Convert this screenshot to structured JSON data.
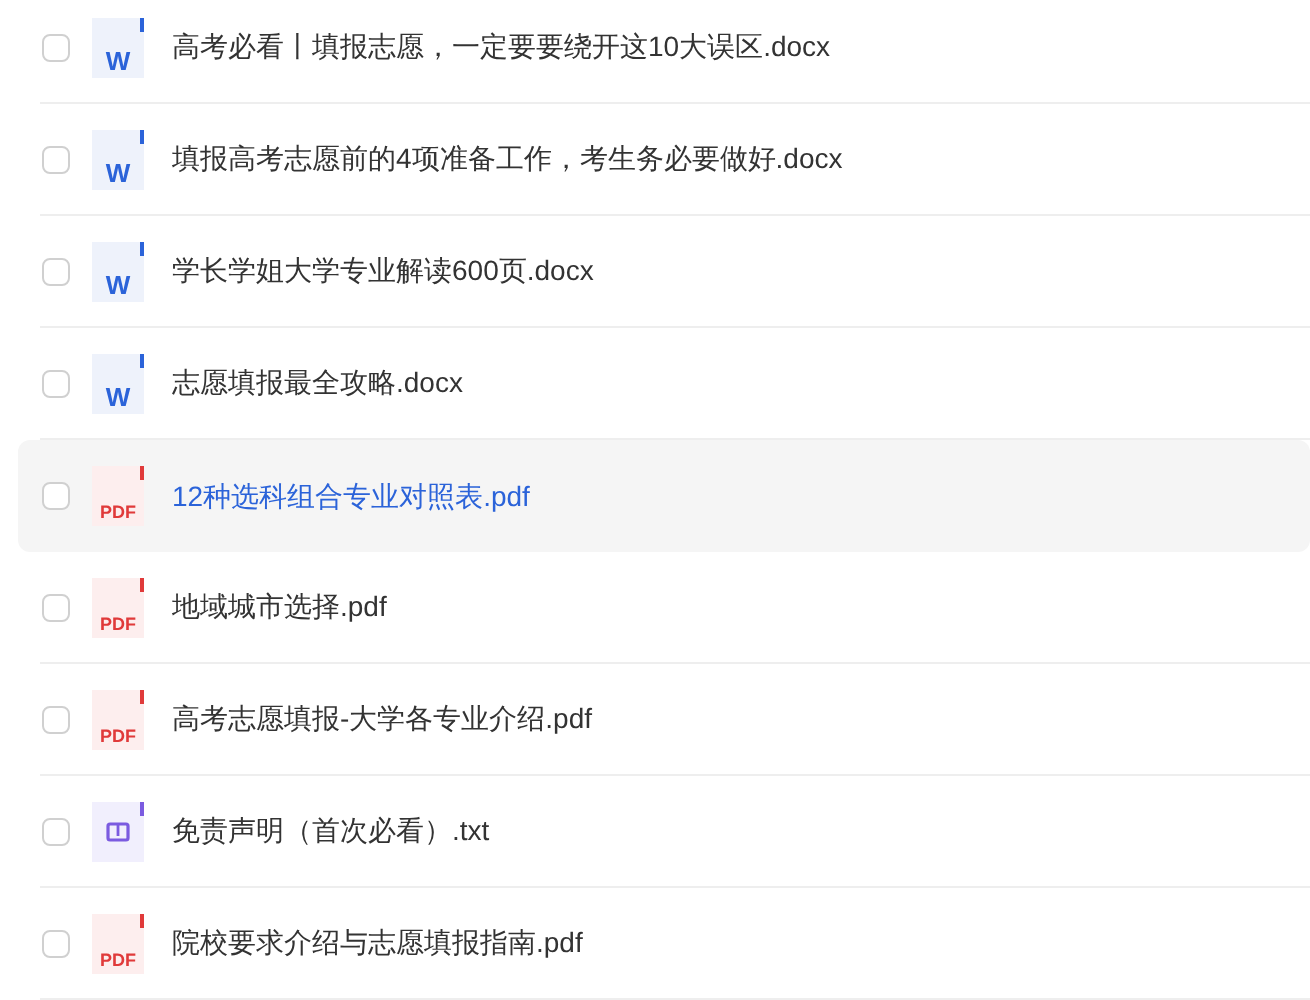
{
  "files": [
    {
      "name": "高考必看丨填报志愿，一定要要绕开这10大误区.docx",
      "kind": "docx",
      "icon_label": "W",
      "checked": false,
      "highlighted": false
    },
    {
      "name": "填报高考志愿前的4项准备工作，考生务必要做好.docx",
      "kind": "docx",
      "icon_label": "W",
      "checked": false,
      "highlighted": false
    },
    {
      "name": "学长学姐大学专业解读600页.docx",
      "kind": "docx",
      "icon_label": "W",
      "checked": false,
      "highlighted": false
    },
    {
      "name": "志愿填报最全攻略.docx",
      "kind": "docx",
      "icon_label": "W",
      "checked": false,
      "highlighted": false
    },
    {
      "name": "12种选科组合专业对照表.pdf",
      "kind": "pdf",
      "icon_label": "PDF",
      "checked": false,
      "highlighted": true
    },
    {
      "name": "地域城市选择.pdf",
      "kind": "pdf",
      "icon_label": "PDF",
      "checked": false,
      "highlighted": false
    },
    {
      "name": "高考志愿填报-大学各专业介绍.pdf",
      "kind": "pdf",
      "icon_label": "PDF",
      "checked": false,
      "highlighted": false
    },
    {
      "name": "免责声明（首次必看）.txt",
      "kind": "txt",
      "checked": false,
      "highlighted": false
    },
    {
      "name": "院校要求介绍与志愿填报指南.pdf",
      "kind": "pdf",
      "icon_label": "PDF",
      "checked": false,
      "highlighted": false
    }
  ]
}
